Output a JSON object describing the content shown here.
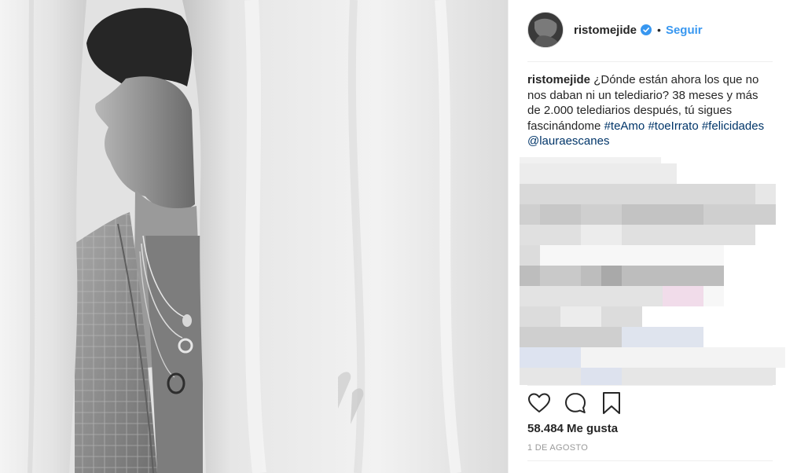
{
  "post": {
    "username": "ristomejide",
    "follow_label": "Seguir",
    "separator": "•",
    "caption": {
      "username": "ristomejide",
      "text": "¿Dónde están ahora los que no nos daban ni un telediario? 38 meses y más de 2.000 telediarios después, tú sigues fascinándome",
      "tags": [
        "#teAmo",
        "#toeIrrato",
        "#felicidades",
        "@lauraescanes"
      ]
    },
    "likes": "58.484 Me gusta",
    "date": "1 DE AGOSTO"
  },
  "icons": {
    "avatar": "avatar-photo",
    "verified": "verified-badge-icon",
    "like": "heart-icon",
    "comment": "comment-bubble-icon",
    "save": "bookmark-icon"
  },
  "colors": {
    "accent": "#3897f0",
    "tag": "#003569",
    "verified": "#3897f0",
    "muted": "#999999",
    "text": "#262626"
  }
}
